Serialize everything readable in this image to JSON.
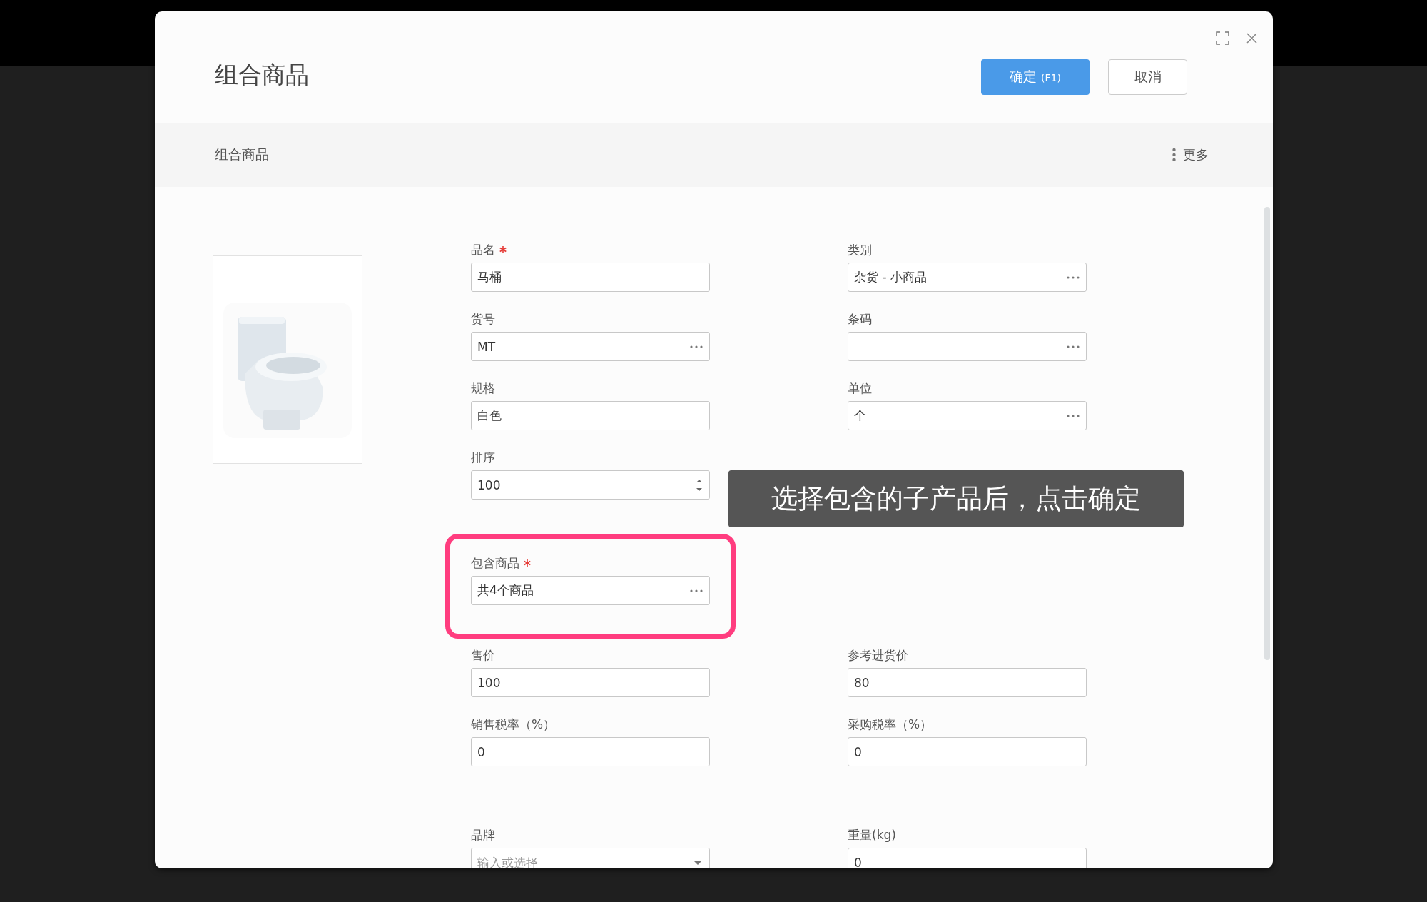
{
  "dialog": {
    "title": "组合商品",
    "confirm_button": "确定",
    "confirm_shortcut": "(F1)",
    "cancel_button": "取消"
  },
  "section": {
    "title": "组合商品",
    "more_button": "更多"
  },
  "groups": [
    {
      "highlighted": false,
      "rows": [
        {
          "left": {
            "label": "品名",
            "required": true,
            "kind": "text",
            "value": "马桶"
          },
          "right": {
            "label": "类别",
            "required": false,
            "kind": "picker",
            "value": "杂货 - 小商品"
          }
        },
        {
          "left": {
            "label": "货号",
            "required": false,
            "kind": "picker",
            "value": "MT"
          },
          "right": {
            "label": "条码",
            "required": false,
            "kind": "picker"
          }
        },
        {
          "left": {
            "label": "规格",
            "required": false,
            "kind": "text",
            "value": "白色"
          },
          "right": {
            "label": "单位",
            "required": false,
            "kind": "picker",
            "value": "个"
          }
        },
        {
          "left": {
            "label": "排序",
            "required": false,
            "kind": "number",
            "value": "100"
          }
        }
      ]
    },
    {
      "highlighted": true,
      "rows": [
        {
          "left": {
            "label": "包含商品",
            "required": true,
            "kind": "picker",
            "value": "共4个商品"
          }
        }
      ]
    },
    {
      "highlighted": false,
      "rows": [
        {
          "left": {
            "label": "售价",
            "required": false,
            "kind": "text",
            "value": "100"
          },
          "right": {
            "label": "参考进货价",
            "required": false,
            "kind": "text",
            "value": "80"
          }
        },
        {
          "left": {
            "label": "销售税率（%）",
            "required": false,
            "kind": "text",
            "value": "0"
          },
          "right": {
            "label": "采购税率（%）",
            "required": false,
            "kind": "text",
            "value": "0"
          }
        }
      ]
    },
    {
      "highlighted": false,
      "rows": [
        {
          "left": {
            "label": "品牌",
            "required": false,
            "kind": "select",
            "placeholder": "输入或选择"
          },
          "right": {
            "label": "重量(kg)",
            "required": false,
            "kind": "text",
            "value": "0"
          }
        }
      ]
    }
  ],
  "callout": "选择包含的子产品后，点击确定"
}
